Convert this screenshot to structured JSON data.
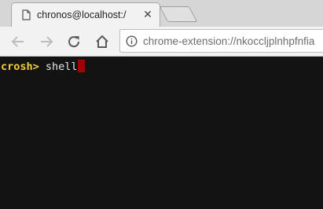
{
  "tab": {
    "title": "chronos@localhost:/",
    "close": "✕",
    "favicon": "page-icon"
  },
  "toolbar": {
    "back_icon": "arrow-left-icon",
    "forward_icon": "arrow-right-icon",
    "reload_icon": "reload-icon",
    "home_icon": "home-icon"
  },
  "omnibox": {
    "info_icon": "info-icon",
    "url": "chrome-extension://nkoccljplnhpfnfia"
  },
  "terminal": {
    "prompt": "crosh>",
    "command": "shell",
    "prompt_color": "#f3cf33",
    "cursor_color": "#a00000"
  }
}
